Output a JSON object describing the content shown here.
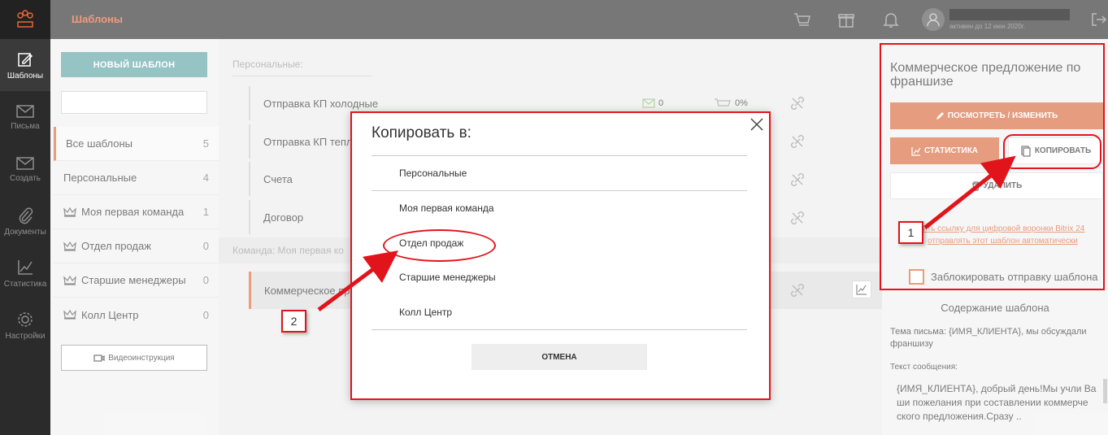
{
  "app": {
    "section_title": "Шаблоны"
  },
  "user": {
    "active_until": "активен до 12 июн 2020г."
  },
  "rail": [
    {
      "label": "Шаблоны",
      "icon": "templates-icon"
    },
    {
      "label": "Письма",
      "icon": "letters-icon"
    },
    {
      "label": "Создать",
      "icon": "create-icon"
    },
    {
      "label": "Документы",
      "icon": "documents-icon"
    },
    {
      "label": "Статистика",
      "icon": "statistics-icon"
    },
    {
      "label": "Настройки",
      "icon": "settings-icon"
    }
  ],
  "left": {
    "new_button": "НОВЫЙ ШАБЛОН",
    "search_placeholder": "",
    "categories": [
      {
        "name": "Все шаблоны",
        "count": "5"
      },
      {
        "name": "Персональные",
        "count": "4"
      },
      {
        "name": "Моя первая команда",
        "count": "1"
      },
      {
        "name": "Отдел продаж",
        "count": "0"
      },
      {
        "name": "Старшие менеджеры",
        "count": "0"
      },
      {
        "name": "Колл Центр",
        "count": "0"
      }
    ],
    "video_button": "Видеоинструкция"
  },
  "center": {
    "section_personal": "Персональные:",
    "section_team": "Команда: Моя первая ко",
    "templates": [
      {
        "name": "Отправка КП холодные",
        "letters": "0",
        "conversion": "0%"
      },
      {
        "name": "Отправка КП тепл",
        "letters": "",
        "conversion": ""
      },
      {
        "name": "Счета",
        "letters": "",
        "conversion": ""
      },
      {
        "name": "Договор",
        "letters": "",
        "conversion": ""
      },
      {
        "name": "Коммерческое пр",
        "letters": "",
        "conversion": ""
      }
    ]
  },
  "right": {
    "title": "Коммерческое предложение по франшизе",
    "view_edit": "ПОСМОТРЕТЬ / ИЗМЕНИТЬ",
    "statistics": "СТАТИСТИКА",
    "copy": "КОПИРОВАТЬ",
    "delete": "УДАЛИТЬ",
    "link1": "ить ссылку для цифровой воронки Bitrix 24",
    "link2": "отправлять этот шаблон автоматически",
    "block_label": "Заблокировать отправку шаблона",
    "content_title": "Содержание шаблона",
    "subject_label": "Тема письма: {ИМЯ_КЛИЕНТА}, мы обсуждали франшизу",
    "text_label": "Текст сообщения:",
    "body": "{ИМЯ_КЛИЕНТА}, добрый день!Мы учли Ва ши пожелания при составлении коммерче ского предложения.Сразу .."
  },
  "modal": {
    "title": "Копировать в:",
    "options": [
      "Персональные",
      "Моя первая команда",
      "Отдел продаж",
      "Старшие менеджеры",
      "Колл Центр"
    ],
    "cancel": "ОТМЕНА"
  },
  "annotations": {
    "badge1": "1",
    "badge2": "2"
  },
  "colors": {
    "accent": "#d9673a",
    "teal": "#5fa3a3",
    "annotation": "#e1141c"
  }
}
